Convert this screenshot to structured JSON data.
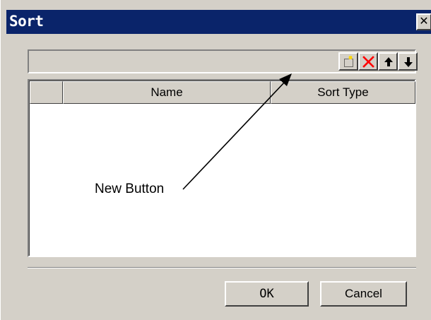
{
  "window": {
    "title": "Sort",
    "close_glyph": "✕"
  },
  "toolbar": {
    "buttons": [
      {
        "name": "new-icon"
      },
      {
        "name": "delete-icon"
      },
      {
        "name": "move-up-icon"
      },
      {
        "name": "move-down-icon"
      }
    ],
    "delete_color": "#ff0000"
  },
  "grid": {
    "columns": [
      "",
      "Name",
      "Sort Type"
    ],
    "rows": []
  },
  "dialog": {
    "ok_label": "OK",
    "cancel_label": "Cancel"
  },
  "annotation": {
    "label": "New Button"
  },
  "colors": {
    "title_bar": "#0a246a",
    "face": "#d4d0c8"
  }
}
